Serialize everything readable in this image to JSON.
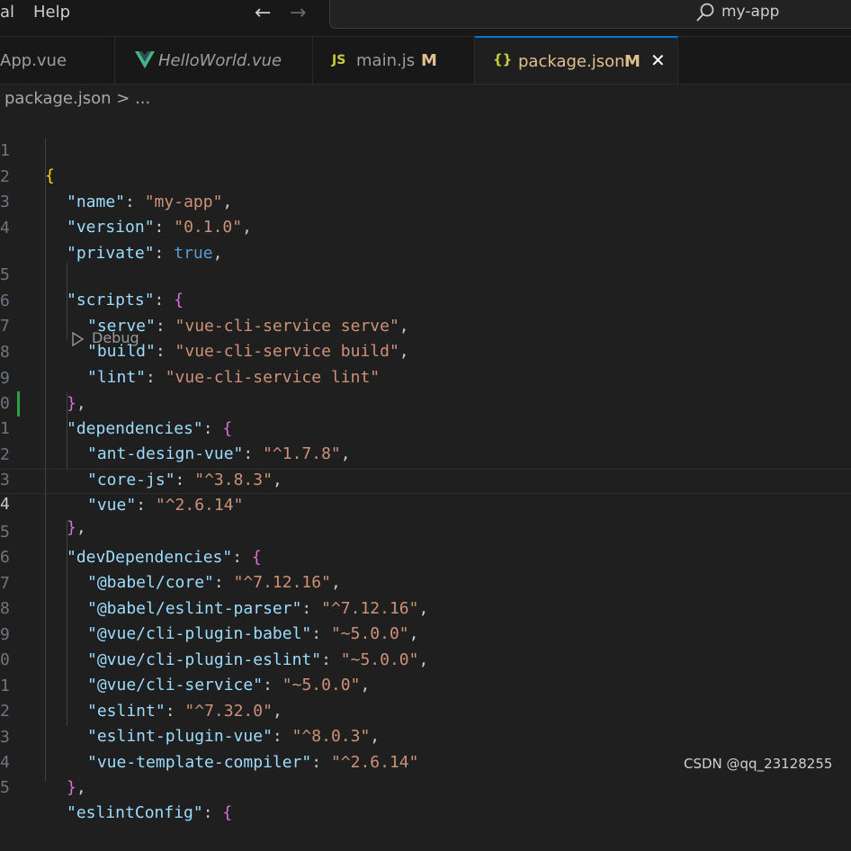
{
  "menu": {
    "item_view_partial": "al",
    "item_help": "Help"
  },
  "search": {
    "text": "my-app"
  },
  "tabs": [
    {
      "label": "App.vue",
      "icon": "",
      "modified": ""
    },
    {
      "label": "HelloWorld.vue",
      "icon": "vue-icon",
      "modified": ""
    },
    {
      "label": "main.js",
      "icon": "js-icon",
      "icon_text": "JS",
      "modified": "M"
    },
    {
      "label": "package.json",
      "icon": "json-icon",
      "icon_text": "{}",
      "modified": "M",
      "active": true
    }
  ],
  "breadcrumb": {
    "file": "package.json",
    "separator": ">",
    "more": "..."
  },
  "codelens": {
    "label": "Debug"
  },
  "editor": {
    "line_numbers": [
      "1",
      "2",
      "3",
      "4",
      "5",
      "6",
      "7",
      "8",
      "9",
      "0",
      "1",
      "2",
      "3",
      "4",
      "5",
      "6",
      "7",
      "8",
      "9",
      "0",
      "1",
      "2",
      "3",
      "4",
      "5"
    ],
    "current_line_number": "4"
  },
  "code_lines": [
    "{",
    "\"name\": \"my-app\",",
    "\"version\": \"0.1.0\",",
    "\"private\": true,",
    "\"scripts\": {",
    "\"serve\": \"vue-cli-service serve\",",
    "\"build\": \"vue-cli-service build\",",
    "\"lint\": \"vue-cli-service lint\"",
    "},",
    "\"dependencies\": {",
    "\"ant-design-vue\": \"^1.7.8\",",
    "\"core-js\": \"^3.8.3\",",
    "\"vue\": \"^2.6.14\"",
    "},",
    "\"devDependencies\": {",
    "\"@babel/core\": \"^7.12.16\",",
    "\"@babel/eslint-parser\": \"^7.12.16\",",
    "\"@vue/cli-plugin-babel\": \"~5.0.0\",",
    "\"@vue/cli-plugin-eslint\": \"~5.0.0\",",
    "\"@vue/cli-service\": \"~5.0.0\",",
    "\"eslint\": \"^7.32.0\",",
    "\"eslint-plugin-vue\": \"^8.0.3\",",
    "\"vue-template-compiler\": \"^2.6.14\"",
    "},",
    "\"eslintConfig\": {"
  ],
  "watermark": "CSDN @qq_23128255",
  "colors": {
    "accent": "#0078d4",
    "json_key": "#9cdcfe",
    "json_string": "#ce9178",
    "json_bool": "#569cd6",
    "git_added": "#2ea043"
  }
}
